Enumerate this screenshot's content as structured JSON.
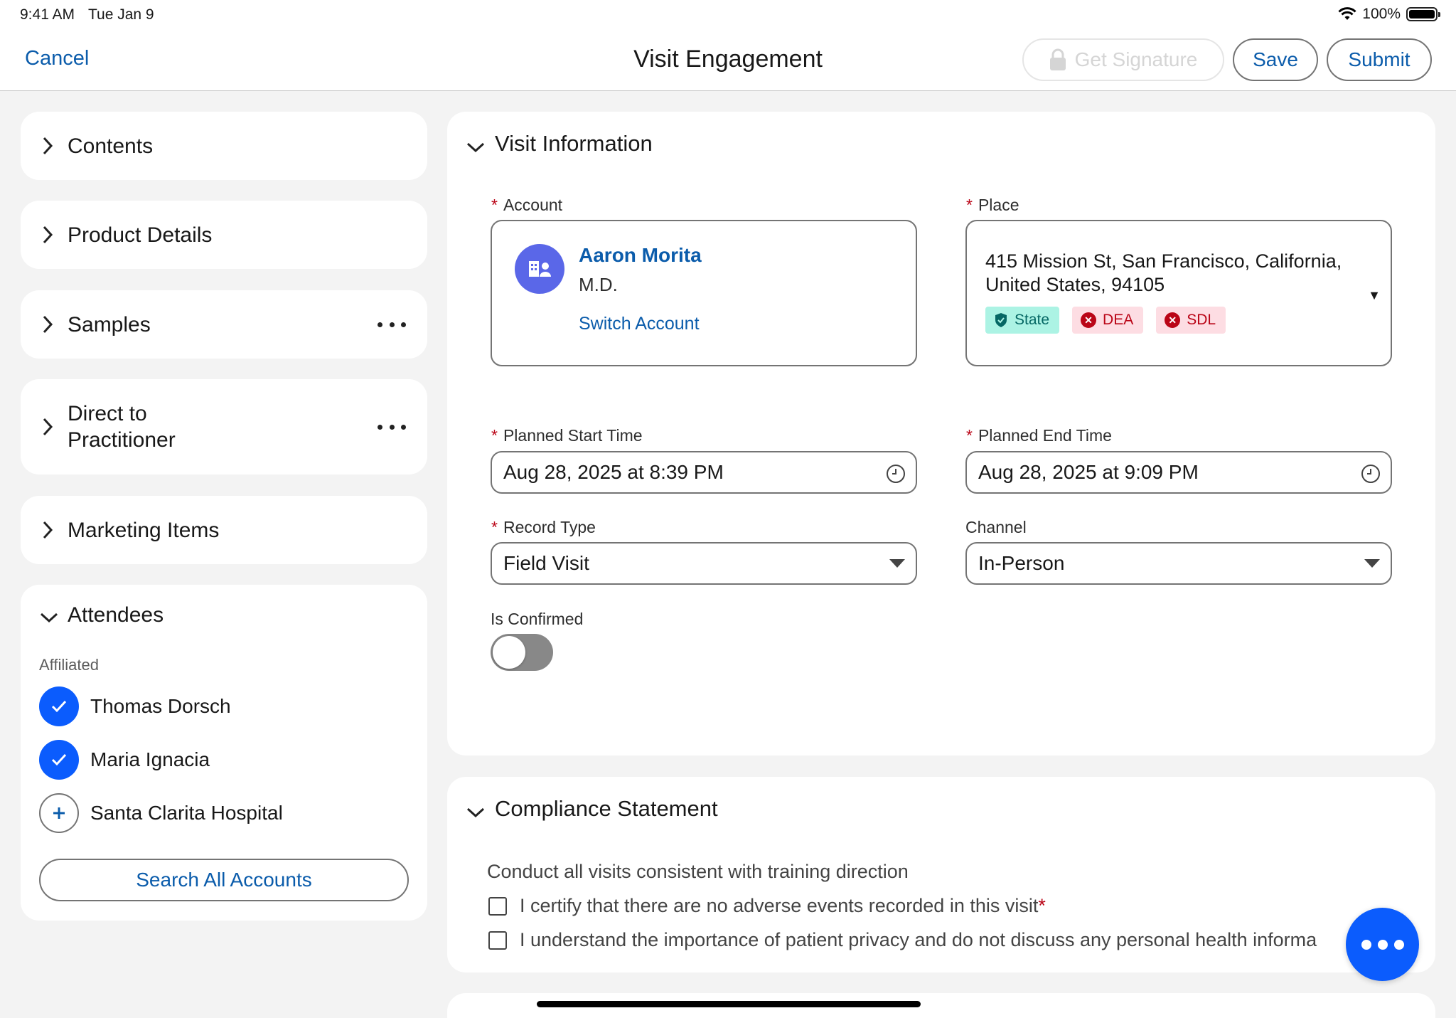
{
  "status_bar": {
    "time": "9:41 AM",
    "date": "Tue Jan 9",
    "battery": "100%"
  },
  "header": {
    "cancel_label": "Cancel",
    "title": "Visit Engagement",
    "get_signature_label": "Get Signature",
    "save_label": "Save",
    "submit_label": "Submit"
  },
  "sidebar": {
    "sections": [
      {
        "label": "Contents"
      },
      {
        "label": "Product Details"
      },
      {
        "label": "Samples"
      },
      {
        "label": "Direct to Practitioner"
      },
      {
        "label": "Marketing Items"
      }
    ],
    "attendees": {
      "title": "Attendees",
      "group_label": "Affiliated",
      "items": [
        {
          "name": "Thomas Dorsch",
          "selected": true
        },
        {
          "name": "Maria Ignacia",
          "selected": true
        },
        {
          "name": "Santa Clarita Hospital",
          "selected": false
        }
      ],
      "search_label": "Search All Accounts"
    }
  },
  "visit_info": {
    "title": "Visit Information",
    "account": {
      "label": "Account",
      "name": "Aaron Morita",
      "credentials": "M.D.",
      "switch_label": "Switch Account"
    },
    "place": {
      "label": "Place",
      "address": "415 Mission St, San Francisco, California, United States, 94105",
      "badges": [
        {
          "label": "State",
          "status": "valid"
        },
        {
          "label": "DEA",
          "status": "invalid"
        },
        {
          "label": "SDL",
          "status": "invalid"
        }
      ]
    },
    "planned_start": {
      "label": "Planned Start Time",
      "value": "Aug 28, 2025 at 8:39 PM"
    },
    "planned_end": {
      "label": "Planned End Time",
      "value": "Aug 28, 2025 at 9:09 PM"
    },
    "record_type": {
      "label": "Record Type",
      "value": "Field Visit"
    },
    "channel": {
      "label": "Channel",
      "value": "In-Person"
    },
    "is_confirmed": {
      "label": "Is Confirmed",
      "value": false
    }
  },
  "compliance": {
    "title": "Compliance Statement",
    "description": "Conduct all visits consistent with training direction",
    "items": [
      {
        "text": "I certify that there are no adverse events recorded in this visit",
        "required": "*"
      },
      {
        "text": "I understand the importance of patient privacy and do not discuss any personal health informa",
        "required": ""
      }
    ]
  },
  "colors": {
    "brand_blue": "#0b5cab",
    "fab_blue": "#0b5cfd",
    "required_red": "#ba0517",
    "avatar_purple": "#5a67e8"
  },
  "icons": [
    "wifi-icon",
    "battery-icon",
    "lock-icon",
    "chevron-right-icon",
    "chevron-down-icon",
    "more-icon",
    "checkmark-icon",
    "plus-icon",
    "account-icon",
    "clock-icon",
    "dropdown-triangle-icon",
    "shield-check-icon",
    "close-circle-icon"
  ]
}
